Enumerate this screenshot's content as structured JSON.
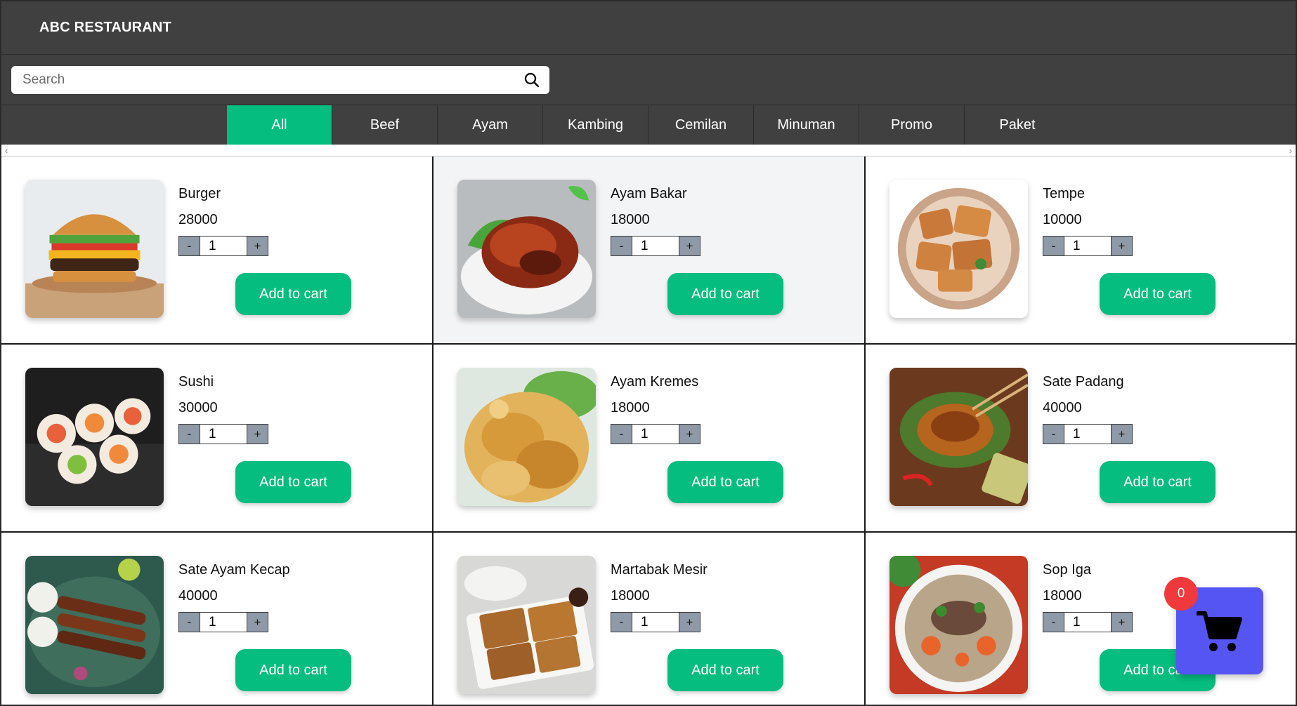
{
  "header": {
    "brand": "ABC RESTAURANT"
  },
  "search": {
    "placeholder": "Search",
    "value": ""
  },
  "categories": [
    {
      "label": "All",
      "active": true
    },
    {
      "label": "Beef",
      "active": false
    },
    {
      "label": "Ayam",
      "active": false
    },
    {
      "label": "Kambing",
      "active": false
    },
    {
      "label": "Cemilan",
      "active": false
    },
    {
      "label": "Minuman",
      "active": false
    },
    {
      "label": "Promo",
      "active": false
    },
    {
      "label": "Paket",
      "active": false
    }
  ],
  "products": [
    {
      "name": "Burger",
      "price": "28000",
      "qty": "1",
      "image": "burger"
    },
    {
      "name": "Ayam Bakar",
      "price": "18000",
      "qty": "1",
      "image": "grilled-chicken"
    },
    {
      "name": "Tempe",
      "price": "10000",
      "qty": "1",
      "image": "tempeh"
    },
    {
      "name": "Sushi",
      "price": "30000",
      "qty": "1",
      "image": "sushi"
    },
    {
      "name": "Ayam Kremes",
      "price": "18000",
      "qty": "1",
      "image": "fried-chicken"
    },
    {
      "name": "Sate Padang",
      "price": "40000",
      "qty": "1",
      "image": "satay-padang"
    },
    {
      "name": "Sate Ayam Kecap",
      "price": "40000",
      "qty": "1",
      "image": "chicken-satay"
    },
    {
      "name": "Martabak Mesir",
      "price": "18000",
      "qty": "1",
      "image": "martabak"
    },
    {
      "name": "Sop Iga",
      "price": "18000",
      "qty": "1",
      "image": "rib-soup"
    }
  ],
  "labels": {
    "add_to_cart": "Add to cart",
    "minus": "-",
    "plus": "+"
  },
  "cart": {
    "count": "0"
  },
  "colors": {
    "accent": "#05bd7f",
    "header": "#404040",
    "cart": "#5555f4",
    "badge": "#f0393c"
  }
}
